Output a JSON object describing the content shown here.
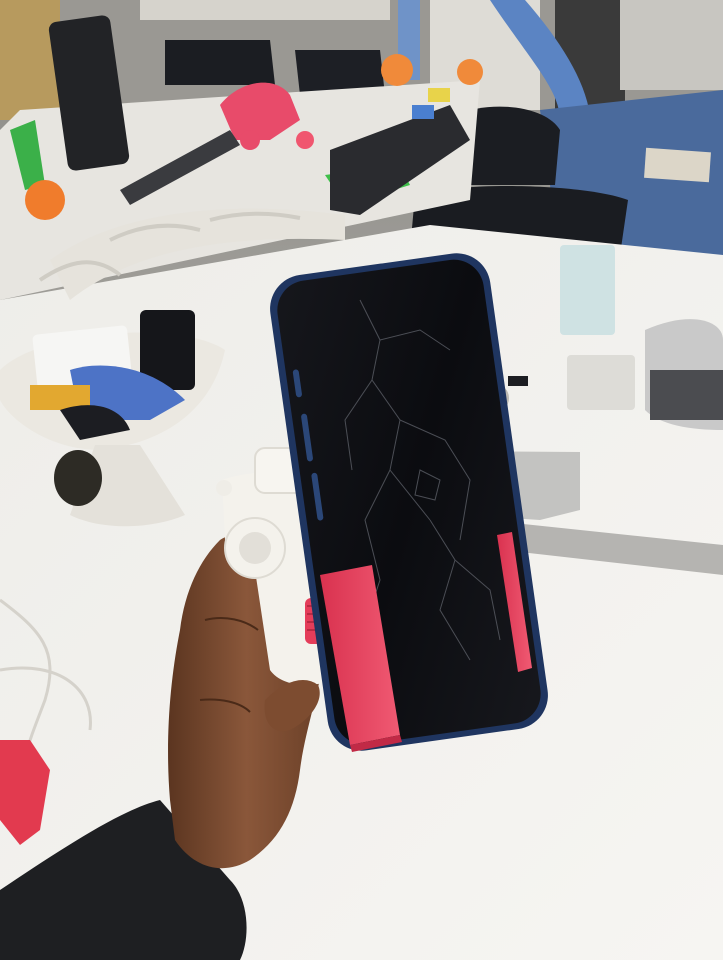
{
  "scene": {
    "kind": "photo",
    "colors": {
      "table_top": "#f1f0ec",
      "floor_carpet": "#4a6a9c",
      "phone_screen": "#0d0e12",
      "phone_frame": "#1f3560",
      "clamp_pads": "#e8435e",
      "printed_mount": "#f4f2ec",
      "skin": "#7a4a2e",
      "sleeve": "#1e1f22",
      "chairs": "#1b1d22"
    }
  }
}
